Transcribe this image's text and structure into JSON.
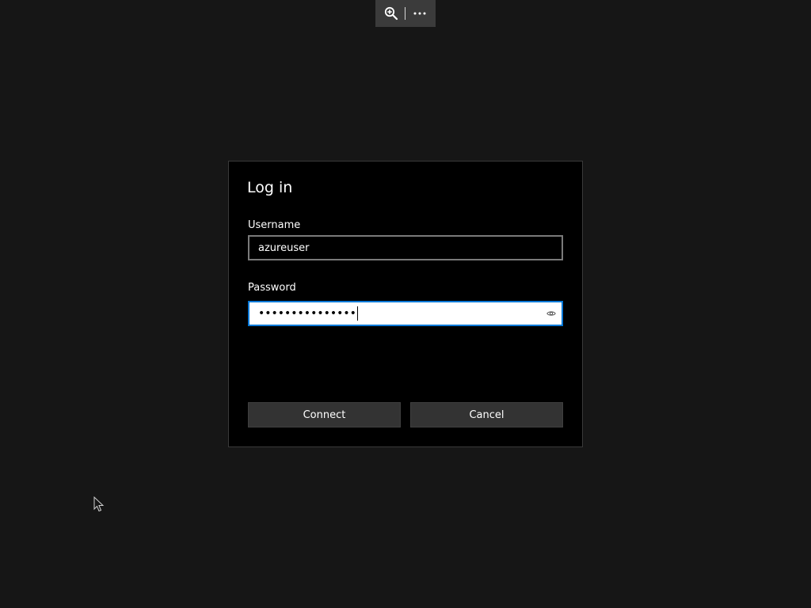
{
  "toolbar": {
    "zoom_icon": "zoom-in-icon",
    "more_icon": "more-horizontal-icon"
  },
  "dialog": {
    "title": "Log in",
    "username_label": "Username",
    "username_value": "azureuser",
    "password_label": "Password",
    "password_masked": "•••••••••••••••",
    "reveal_icon": "eye-icon",
    "connect_label": "Connect",
    "cancel_label": "Cancel"
  },
  "colors": {
    "background": "#161616",
    "dialog_bg": "#000000",
    "focus_accent": "#0078d7",
    "button_bg": "#333333"
  }
}
